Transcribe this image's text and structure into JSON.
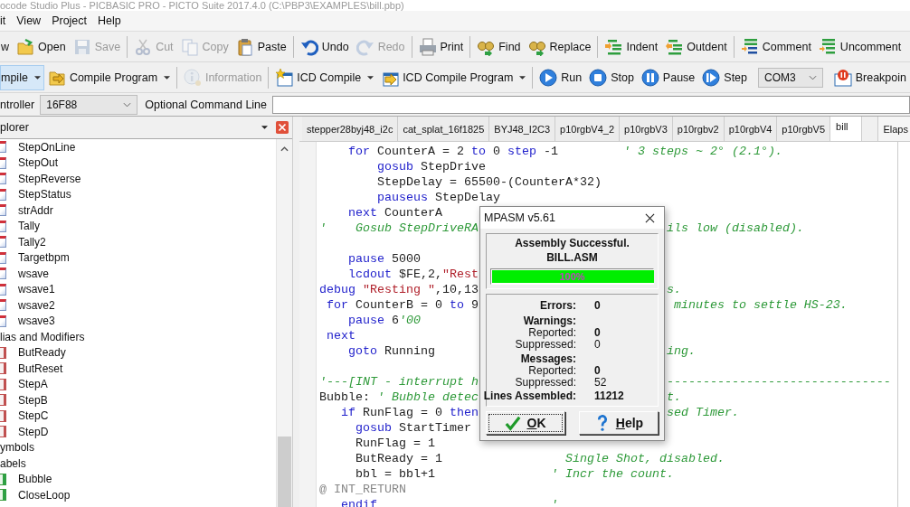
{
  "window": {
    "title": "ocode Studio Plus - PICBASIC PRO - PICTO Suite 2017.4.0 (C:\\PBP3\\EXAMPLES\\bill.pbp)"
  },
  "menu": [
    "it",
    "View",
    "Project",
    "Help"
  ],
  "toolbar_1": [
    {
      "items": [
        {
          "label": "w",
          "disabled": false
        },
        {
          "label": "Open",
          "disabled": false
        },
        {
          "label": "Save",
          "disabled": true
        }
      ]
    },
    {
      "items": [
        {
          "label": "Cut",
          "disabled": true
        },
        {
          "label": "Copy",
          "disabled": true
        },
        {
          "label": "Paste",
          "disabled": false
        }
      ]
    },
    {
      "items": [
        {
          "label": "Undo",
          "disabled": false
        },
        {
          "label": "Redo",
          "disabled": true
        }
      ]
    },
    {
      "items": [
        {
          "label": "Print",
          "disabled": false
        }
      ]
    },
    {
      "items": [
        {
          "label": "Find",
          "disabled": false
        },
        {
          "label": "Replace",
          "disabled": false
        }
      ]
    },
    {
      "items": [
        {
          "label": "Indent",
          "disabled": false
        },
        {
          "label": "Outdent",
          "disabled": false
        }
      ]
    },
    {
      "items": [
        {
          "label": "Comment",
          "disabled": false
        },
        {
          "label": "Uncomment",
          "disabled": false
        }
      ]
    }
  ],
  "toolbar_2": [
    {
      "items": [
        {
          "kind": "button",
          "label": "mpile",
          "disabled": false,
          "dropdown": true,
          "highlighted": true
        },
        {
          "kind": "button",
          "label": "Compile Program",
          "disabled": false,
          "dropdown": true,
          "highlighted": false
        }
      ]
    },
    {
      "items": [
        {
          "kind": "button",
          "label": "Information",
          "disabled": true,
          "dropdown": false,
          "highlighted": false
        }
      ]
    },
    {
      "items": [
        {
          "kind": "button",
          "label": "ICD Compile",
          "disabled": false,
          "dropdown": true,
          "highlighted": false
        },
        {
          "kind": "button",
          "label": "ICD Compile Program",
          "disabled": false,
          "dropdown": true,
          "highlighted": false
        }
      ]
    },
    {
      "items": [
        {
          "kind": "button",
          "label": "Run",
          "disabled": false,
          "dropdown": false,
          "highlighted": false
        },
        {
          "kind": "button",
          "label": "Stop",
          "disabled": false,
          "dropdown": false,
          "highlighted": false
        },
        {
          "kind": "button",
          "label": "Pause",
          "disabled": false,
          "dropdown": false,
          "highlighted": false
        },
        {
          "kind": "button",
          "label": "Step",
          "disabled": false,
          "dropdown": false,
          "highlighted": false
        },
        {
          "kind": "combo",
          "label": "COM3",
          "dropdown": true
        },
        {
          "kind": "button",
          "label": "Breakpoin",
          "disabled": false,
          "dropdown": false,
          "highlighted": false
        }
      ]
    }
  ],
  "controller_bar": {
    "label": "ntroller",
    "device": "16F88",
    "command_label": "Optional Command Line"
  },
  "explorer": {
    "title": "plorer",
    "items": [
      {
        "label": "StepOnLine",
        "kind": "variable"
      },
      {
        "label": "StepOut",
        "kind": "variable"
      },
      {
        "label": "StepReverse",
        "kind": "variable"
      },
      {
        "label": "StepStatus",
        "kind": "variable"
      },
      {
        "label": "strAddr",
        "kind": "variable"
      },
      {
        "label": "Tally",
        "kind": "variable"
      },
      {
        "label": "Tally2",
        "kind": "variable"
      },
      {
        "label": "Targetbpm",
        "kind": "variable"
      },
      {
        "label": "wsave",
        "kind": "variable"
      },
      {
        "label": "wsave1",
        "kind": "variable"
      },
      {
        "label": "wsave2",
        "kind": "variable"
      },
      {
        "label": "wsave3",
        "kind": "variable"
      }
    ],
    "groups": [
      {
        "label": "lias and Modifiers",
        "children": [
          {
            "label": "ButReady",
            "kind": "alias"
          },
          {
            "label": "ButReset",
            "kind": "alias"
          },
          {
            "label": "StepA",
            "kind": "alias"
          },
          {
            "label": "StepB",
            "kind": "alias"
          },
          {
            "label": "StepC",
            "kind": "alias"
          },
          {
            "label": "StepD",
            "kind": "alias"
          }
        ]
      },
      {
        "label": "ymbols"
      },
      {
        "label": "abels",
        "children": [
          {
            "label": "Bubble",
            "kind": "label"
          },
          {
            "label": "CloseLoop",
            "kind": "label"
          }
        ]
      }
    ]
  },
  "tabs": [
    {
      "label": "stepper28byj48_i2c",
      "selected": false
    },
    {
      "label": "cat_splat_16f1825",
      "selected": false
    },
    {
      "label": "BYJ48_I2C3",
      "selected": false
    },
    {
      "label": "p10rgbV4_2",
      "selected": false
    },
    {
      "label": "p10rgbV3",
      "selected": false
    },
    {
      "label": "p10rgbv2",
      "selected": false
    },
    {
      "label": "p10rgbV4",
      "selected": false
    },
    {
      "label": "p10rgbV5",
      "selected": false
    },
    {
      "label": "bill",
      "selected": true
    }
  ],
  "side_tab": "Elaps",
  "code": [
    {
      "kind": "code",
      "parts": [
        {
          "kind": "keyword",
          "text": "    for"
        },
        {
          "kind": "plain",
          "text": " CounterA = 2 "
        },
        {
          "kind": "keyword",
          "text": "to"
        },
        {
          "kind": "plain",
          "text": " 0 "
        },
        {
          "kind": "keyword",
          "text": "step"
        },
        {
          "kind": "plain",
          "text": " -1"
        },
        {
          "kind": "comment",
          "text": "         ' 3 steps ~ 2° (2.1°)."
        }
      ]
    },
    {
      "kind": "code",
      "parts": [
        {
          "kind": "keyword",
          "text": "        gosub"
        },
        {
          "kind": "plain",
          "text": " StepDrive"
        }
      ]
    },
    {
      "kind": "code",
      "parts": [
        {
          "kind": "plain",
          "text": "        StepDelay = 65500-(CounterA*32)"
        }
      ]
    },
    {
      "kind": "code",
      "parts": [
        {
          "kind": "keyword",
          "text": "        pauseus"
        },
        {
          "kind": "plain",
          "text": " StepDelay"
        }
      ]
    },
    {
      "kind": "code",
      "parts": [
        {
          "kind": "keyword",
          "text": "    next"
        },
        {
          "kind": "plain",
          "text": " CounterA"
        }
      ]
    },
    {
      "kind": "code",
      "parts": [
        {
          "kind": "comment",
          "text": "'    Gosub StepDriveRA"
        }
      ],
      "tail": "ils low (disabled)."
    },
    {
      "kind": "blank"
    },
    {
      "kind": "code",
      "parts": [
        {
          "kind": "keyword",
          "text": "    pause"
        },
        {
          "kind": "plain",
          "text": " 5000"
        }
      ]
    },
    {
      "kind": "code",
      "parts": [
        {
          "kind": "keyword",
          "text": "    lcdout"
        },
        {
          "kind": "plain",
          "text": " $FE,2,"
        },
        {
          "kind": "string",
          "text": "\"Rest"
        }
      ]
    },
    {
      "kind": "code",
      "parts": [
        {
          "kind": "keyword",
          "text": "debug"
        },
        {
          "kind": "string",
          "text": " \"Resting \""
        },
        {
          "kind": "plain",
          "text": ",10,13"
        }
      ],
      "tail": "s."
    },
    {
      "kind": "code",
      "parts": [
        {
          "kind": "keyword",
          "text": " for"
        },
        {
          "kind": "plain",
          "text": " CounterB = 0 "
        },
        {
          "kind": "keyword",
          "text": "to"
        },
        {
          "kind": "plain",
          "text": " 9"
        }
      ],
      "tail": " minutes to settle HS-23."
    },
    {
      "kind": "code",
      "parts": [
        {
          "kind": "keyword",
          "text": "    pause"
        },
        {
          "kind": "plain",
          "text": " 6"
        },
        {
          "kind": "comment",
          "text": "'00"
        }
      ]
    },
    {
      "kind": "code",
      "parts": [
        {
          "kind": "keyword",
          "text": " next"
        }
      ]
    },
    {
      "kind": "code",
      "parts": [
        {
          "kind": "keyword",
          "text": "    goto"
        },
        {
          "kind": "plain",
          "text": " Running"
        }
      ],
      "tail": "ing."
    },
    {
      "kind": "blank"
    },
    {
      "kind": "code",
      "parts": [
        {
          "kind": "comment",
          "text": "'---[INT - interrupt h"
        }
      ],
      "tail": "-------------------------------"
    },
    {
      "kind": "code",
      "parts": [
        {
          "kind": "plain",
          "text": "Bubble: "
        },
        {
          "kind": "comment",
          "text": "' Bubble detec"
        }
      ],
      "tail": "t."
    },
    {
      "kind": "code",
      "parts": [
        {
          "kind": "keyword",
          "text": "   if"
        },
        {
          "kind": "plain",
          "text": " RunFlag = 0 "
        },
        {
          "kind": "keyword",
          "text": "then"
        }
      ],
      "tail": "sed Timer."
    },
    {
      "kind": "code",
      "parts": [
        {
          "kind": "keyword",
          "text": "     gosub"
        },
        {
          "kind": "plain",
          "text": " StartTimer"
        }
      ]
    },
    {
      "kind": "code",
      "parts": [
        {
          "kind": "plain",
          "text": "     RunFlag = 1"
        }
      ]
    },
    {
      "kind": "code",
      "parts": [
        {
          "kind": "plain",
          "text": "     ButReady = 1"
        },
        {
          "kind": "comment",
          "text": "                 Single Shot, disabled."
        }
      ]
    },
    {
      "kind": "code",
      "parts": [
        {
          "kind": "plain",
          "text": "     bbl = bbl+1"
        },
        {
          "kind": "comment",
          "text": "                ' Incr the count."
        }
      ]
    },
    {
      "kind": "code",
      "parts": [
        {
          "kind": "directive",
          "text": "@ INT_RETURN"
        }
      ]
    },
    {
      "kind": "code",
      "parts": [
        {
          "kind": "keyword",
          "text": "   endif"
        },
        {
          "kind": "comment",
          "text": "                        '"
        }
      ]
    }
  ],
  "dialog": {
    "title": "MPASM v5.61",
    "status": "Assembly Successful.",
    "file": "BILL.ASM",
    "progress": {
      "level": 1,
      "reading": "100%"
    },
    "stats": [
      {
        "kind": "total",
        "label": "Errors:",
        "value": "0"
      },
      {
        "kind": "heading",
        "label": "Warnings:"
      },
      {
        "kind": "sub",
        "label": "Reported:",
        "value": "0",
        "bold": true
      },
      {
        "kind": "sub",
        "label": "Suppressed:",
        "value": "0",
        "bold": false
      },
      {
        "kind": "heading",
        "label": "Messages:"
      },
      {
        "kind": "sub",
        "label": "Reported:",
        "value": "0",
        "bold": true
      },
      {
        "kind": "sub",
        "label": "Suppressed:",
        "value": "52",
        "bold": false
      },
      {
        "kind": "total",
        "label": "Lines Assembled:",
        "value": "11212"
      }
    ],
    "buttons": [
      {
        "label": "OK",
        "focused": true
      },
      {
        "label": "Help",
        "focused": false
      }
    ]
  }
}
